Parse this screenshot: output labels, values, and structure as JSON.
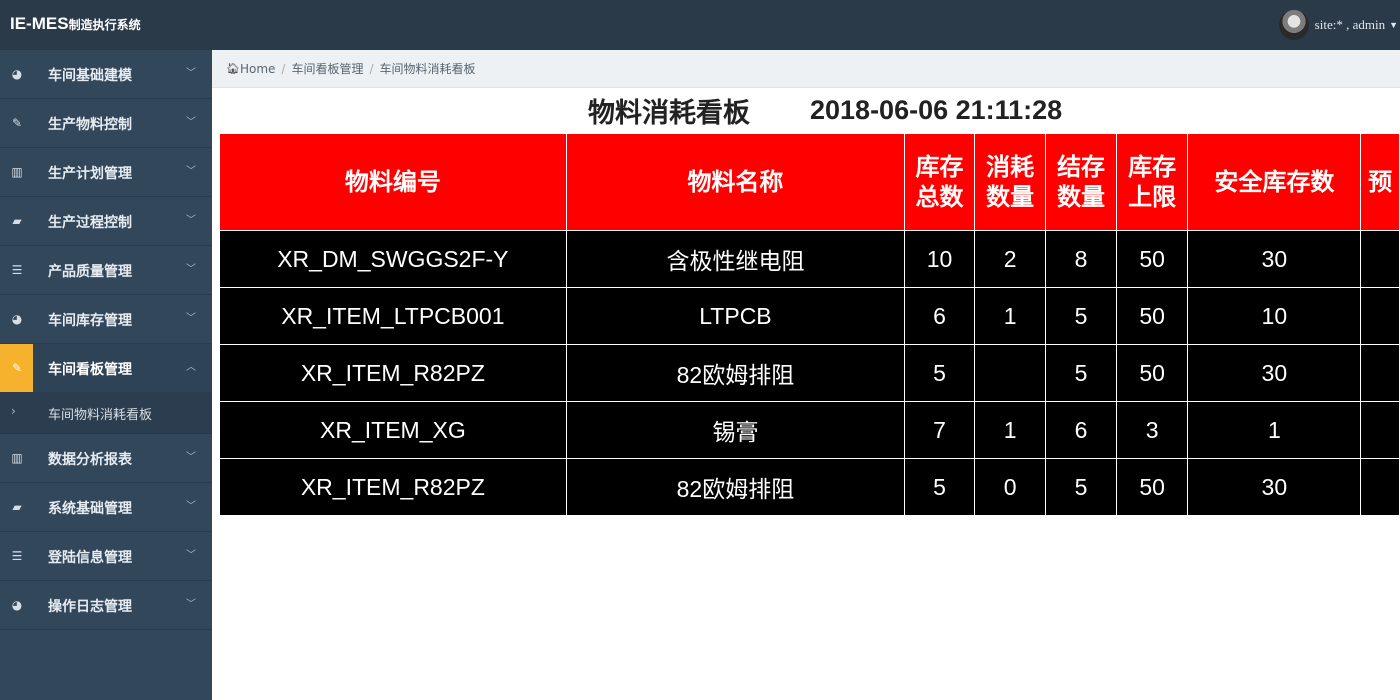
{
  "app": {
    "brand": "IE-MES",
    "brand_sub": "制造执行系统"
  },
  "user": {
    "label": "site:* , admin"
  },
  "sidebar": {
    "items": [
      {
        "label": "车间基础建模",
        "icon": "dashboard-icon",
        "glyph": "◕"
      },
      {
        "label": "生产物料控制",
        "icon": "edit-icon",
        "glyph": "✎"
      },
      {
        "label": "生产计划管理",
        "icon": "columns-icon",
        "glyph": "▥"
      },
      {
        "label": "生产过程控制",
        "icon": "book-icon",
        "glyph": "▰"
      },
      {
        "label": "产品质量管理",
        "icon": "list-icon",
        "glyph": "☰"
      },
      {
        "label": "车间库存管理",
        "icon": "dashboard-icon",
        "glyph": "◕"
      },
      {
        "label": "车间看板管理",
        "icon": "edit-icon",
        "glyph": "✎",
        "active": true,
        "children": [
          {
            "label": "车间物料消耗看板"
          }
        ]
      },
      {
        "label": "数据分析报表",
        "icon": "columns-icon",
        "glyph": "▥"
      },
      {
        "label": "系统基础管理",
        "icon": "book-icon",
        "glyph": "▰"
      },
      {
        "label": "登陆信息管理",
        "icon": "list-icon",
        "glyph": "☰"
      },
      {
        "label": "操作日志管理",
        "icon": "dashboard-icon",
        "glyph": "◕"
      }
    ]
  },
  "breadcrumb": {
    "home": "Home",
    "level1": "车间看板管理",
    "level2": "车间物料消耗看板"
  },
  "board": {
    "title": "物料消耗看板",
    "timestamp": "2018-06-06 21:11:28",
    "columns": [
      "物料编号",
      "物料名称",
      "库存总数",
      "消耗数量",
      "结存数量",
      "库存上限",
      "安全库存数",
      "预"
    ],
    "rows": [
      [
        "XR_DM_SWGGS2F-Y",
        "含极性继电阻",
        "10",
        "2",
        "8",
        "50",
        "30",
        ""
      ],
      [
        "XR_ITEM_LTPCB001",
        "LTPCB",
        "6",
        "1",
        "5",
        "50",
        "10",
        ""
      ],
      [
        "XR_ITEM_R82PZ",
        "82欧姆排阻",
        "5",
        "",
        "5",
        "50",
        "30",
        ""
      ],
      [
        "XR_ITEM_XG",
        "锡膏",
        "7",
        "1",
        "6",
        "3",
        "1",
        ""
      ],
      [
        "XR_ITEM_R82PZ",
        "82欧姆排阻",
        "5",
        "0",
        "5",
        "50",
        "30",
        ""
      ]
    ]
  },
  "colors": {
    "topbar": "#2b3a48",
    "sidebar": "#33475b",
    "active_icon": "#f6b22d",
    "header_bg": "#ff0000",
    "row_bg": "#000000"
  }
}
